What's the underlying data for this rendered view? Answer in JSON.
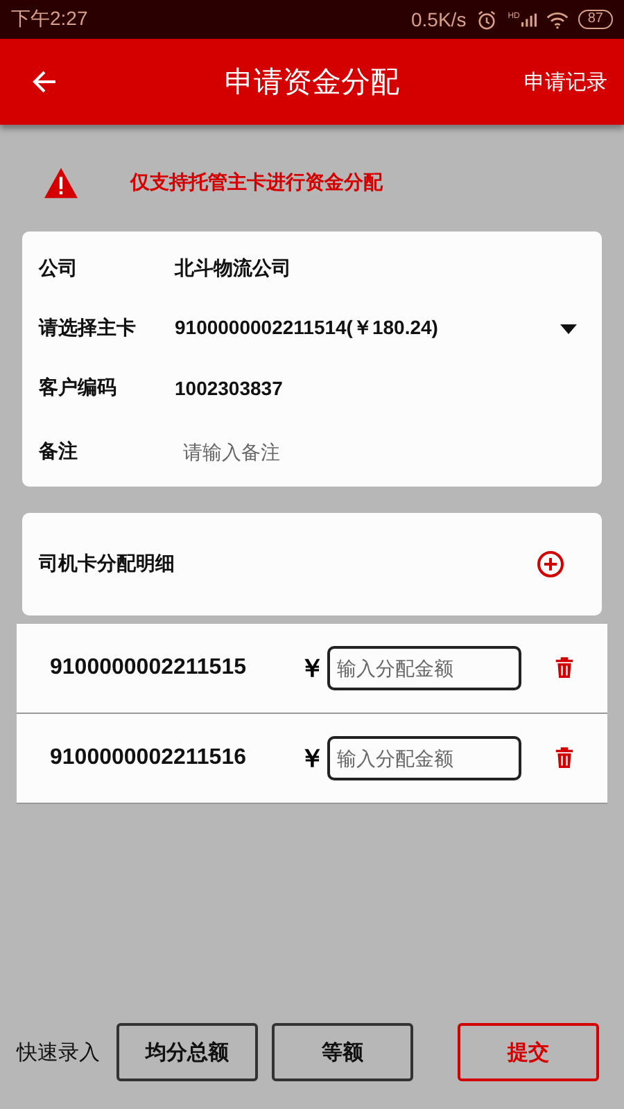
{
  "status_bar": {
    "time": "下午2:27",
    "speed": "0.5K/s",
    "signal_label": "HD",
    "battery": "87"
  },
  "header": {
    "title": "申请资金分配",
    "action": "申请记录"
  },
  "notice": "仅支持托管主卡进行资金分配",
  "form": {
    "fields": [
      {
        "kind": "text",
        "label": "公司",
        "value": "北斗物流公司"
      },
      {
        "kind": "select",
        "label": "请选择主卡",
        "value": "9100000002211514(￥180.24)"
      },
      {
        "kind": "text",
        "label": "客户编码",
        "value": "1002303837"
      },
      {
        "kind": "input",
        "label": "备注",
        "placeholder": "请输入备注"
      }
    ]
  },
  "allocation": {
    "title": "司机卡分配明细",
    "rows": [
      {
        "card": "9100000002211515",
        "currency": "￥",
        "placeholder": "输入分配金额"
      },
      {
        "card": "9100000002211516",
        "currency": "￥",
        "placeholder": "输入分配金额"
      }
    ]
  },
  "footer": {
    "label": "快速录入",
    "buttons": [
      {
        "label": "均分总额",
        "kind": "plain"
      },
      {
        "label": "等额",
        "kind": "plain"
      },
      {
        "label": "提交",
        "kind": "primary"
      }
    ]
  }
}
